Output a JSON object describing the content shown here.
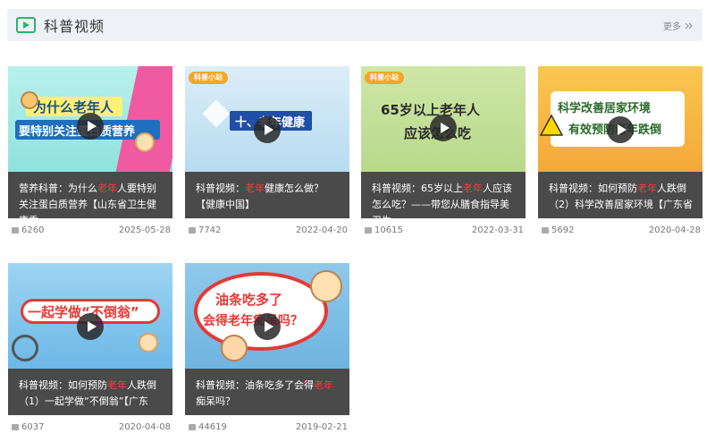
{
  "section": {
    "title": "科普视频",
    "more_label": "更多"
  },
  "colors": {
    "accent_green": "#2fb36b",
    "highlight_red": "#ff3b3b",
    "overlay_bg": "#4a4a4a"
  },
  "videos": [
    {
      "thumb_text_1": "为什么老年人",
      "thumb_text_2": "要特别关注蛋白质营养",
      "title_pre": "营养科普：为什么",
      "title_hl": "老年",
      "title_post": "人要特别关注蛋白质营养【山东省卫生健康委",
      "views": "6260",
      "date": "2025-05-28"
    },
    {
      "thumb_logo": "科普小站",
      "thumb_text_1": "十、老年健康",
      "title_pre": "科普视频：",
      "title_hl": "老年",
      "title_post": "健康怎么做？【健康中国】",
      "views": "7742",
      "date": "2022-04-20"
    },
    {
      "thumb_logo": "科普小站",
      "thumb_text_1": "65岁以上老年人",
      "thumb_text_2": "应该怎么吃",
      "title_pre": "科普视频：65岁以上",
      "title_hl": "老年",
      "title_post": "人应该怎么吃？——带您从膳食指导美卫生",
      "views": "10615",
      "date": "2022-03-31"
    },
    {
      "thumb_text_1": "科学改善居家环境",
      "thumb_text_2": "有效预防老年跌倒",
      "title_pre": "科普视频：如何预防",
      "title_hl": "老年",
      "title_post": "人跌倒（2）科学改善居家环境【广东省",
      "views": "5692",
      "date": "2020-04-28"
    },
    {
      "thumb_text_1": "一起学做“不倒翁”",
      "title_pre": "科普视频：如何预防",
      "title_hl": "老年",
      "title_post": "人跌倒（1）一起学做“不倒翁”【广东",
      "views": "6037",
      "date": "2020-04-08"
    },
    {
      "thumb_text_1": "油条吃多了",
      "thumb_text_2": "会得老年痴呆吗？",
      "title_pre": "科普视频：油条吃多了会得",
      "title_hl": "老年",
      "title_post": "痴呆吗？",
      "views": "44619",
      "date": "2019-02-21"
    }
  ]
}
